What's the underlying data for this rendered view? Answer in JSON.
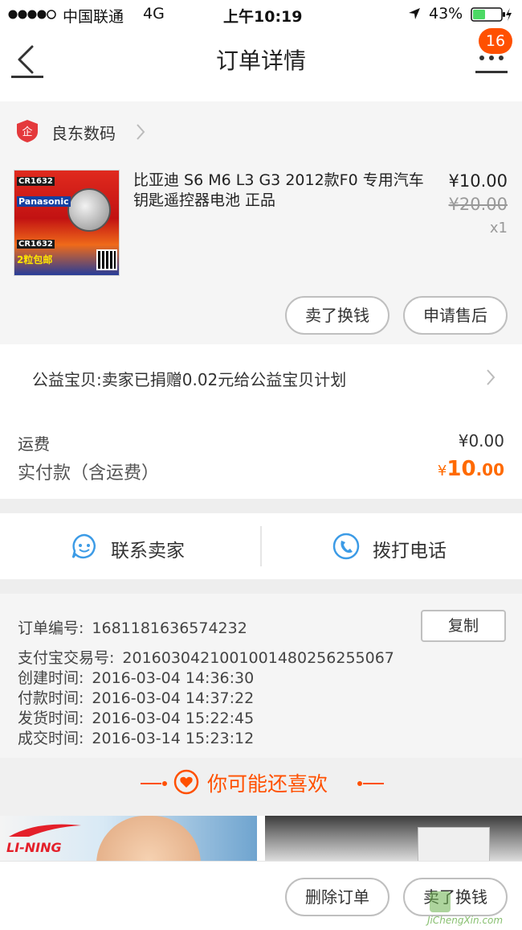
{
  "status_bar": {
    "carrier": "中国联通",
    "network": "4G",
    "time": "上午10:19",
    "battery": "43%",
    "battery_level": 0.43
  },
  "nav": {
    "title": "订单详情",
    "badge": "16"
  },
  "shop": {
    "name": "良东数码"
  },
  "product": {
    "title": "比亚迪 S6 M6 L3  G3 2012款F0 专用汽车钥匙遥控器电池 正品",
    "price": "¥10.00",
    "original_price": "¥20.00",
    "quantity": "x1",
    "image_texts": {
      "model_top": "CR1632",
      "brand": "Panasonic",
      "model_bottom": "CR1632",
      "promo": "2粒包邮"
    }
  },
  "item_actions": {
    "sell_button": "卖了换钱",
    "after_sale_button": "申请售后"
  },
  "charity": {
    "text": "公益宝贝:卖家已捐赠0.02元给公益宝贝计划"
  },
  "cost": {
    "shipping_label": "运费",
    "shipping_value": "¥0.00",
    "paid_label": "实付款（含运费）",
    "paid_currency": "¥",
    "paid_integer": "10",
    "paid_decimal": ".00"
  },
  "contact": {
    "seller_label": "联系卖家",
    "call_label": "拨打电话"
  },
  "order_info": {
    "order_no_label": "订单编号:",
    "order_no": "1681181636574232",
    "copy_button": "复制",
    "alipay_label": "支付宝交易号:",
    "alipay_no": "2016030421001001480256255067",
    "created_label": "创建时间:",
    "created_time": "2016-03-04 14:36:30",
    "paid_label": "付款时间:",
    "paid_time": "2016-03-04 14:37:22",
    "shipped_label": "发货时间:",
    "shipped_time": "2016-03-04 15:22:45",
    "closed_label": "成交时间:",
    "closed_time": "2016-03-14 15:23:12"
  },
  "recommend": {
    "title": "你可能还喜欢",
    "card1_brand": "LI-NING"
  },
  "bottom_bar": {
    "delete_button": "删除订单",
    "sell_button": "卖了换钱"
  },
  "watermark": {
    "text": "JiChengXin.com"
  },
  "colors": {
    "accent": "#ff5000",
    "price_orange": "#ff6a00",
    "icon_blue": "#3c9be6",
    "battery_green": "#4cd964"
  }
}
